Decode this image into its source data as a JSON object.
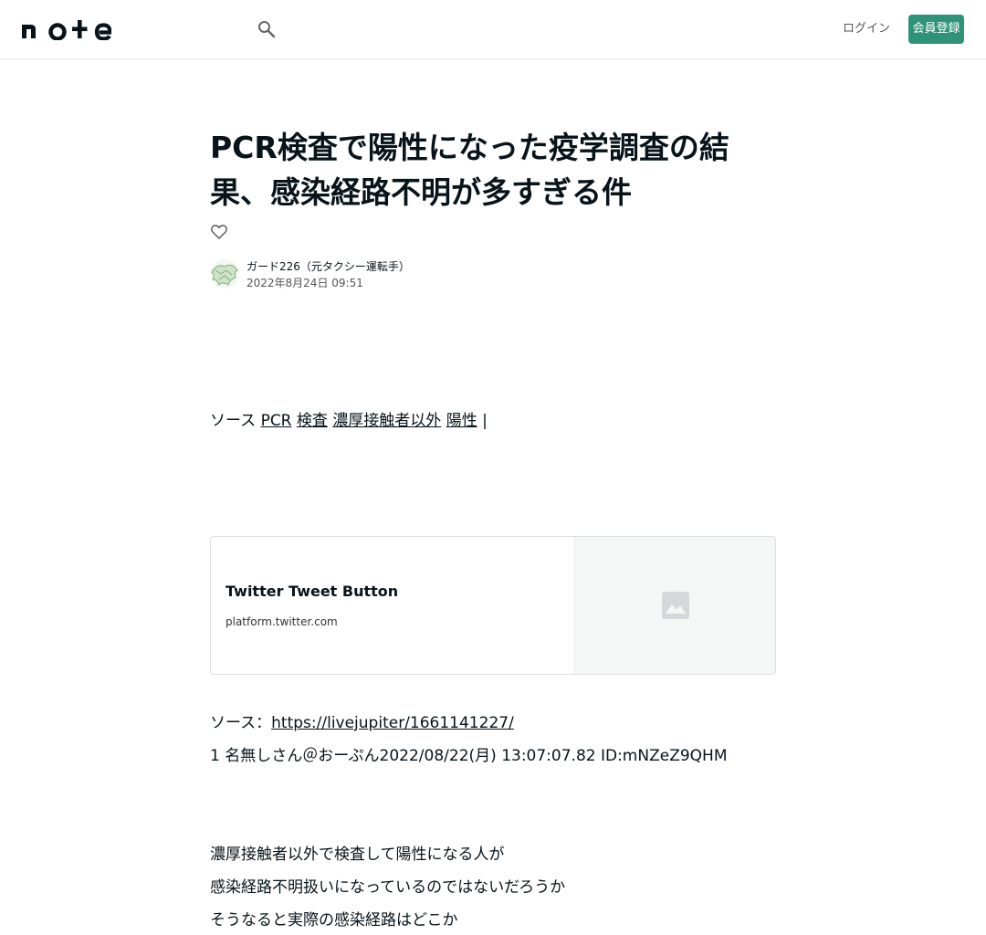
{
  "header": {
    "logo_text": "note",
    "search_icon": "search-icon",
    "login_label": "ログイン",
    "signup_label": "会員登録",
    "accent_color": "#2f9379"
  },
  "article": {
    "title": "PCR検査で陽性になった疫学調査の結果、感染経路不明が多すぎる件",
    "like_icon": "heart-icon",
    "author_name": "ガード226（元タクシー運転手）",
    "date": "2022年8月24日 09:51",
    "tags_prefix": "ソース",
    "tags": [
      "PCR",
      "検査",
      "濃厚接触者以外",
      "陽性"
    ],
    "tags_suffix": "|",
    "embed": {
      "title": "Twitter Tweet Button",
      "domain": "platform.twitter.com",
      "thumb_icon": "image-placeholder-icon"
    },
    "source_prefix": "ソース：",
    "source_link": "https://livejupiter/1661141227/",
    "post_line": "1 名無しさん＠おーぷん2022/08/22(月) 13:07:07.82 ID:mNZeZ9QHM",
    "body_lines": [
      "濃厚接触者以外で検査して陽性になる人が",
      "感染経路不明扱いになっているのではないだろうか",
      "そうなると実際の感染経路はどこか"
    ]
  }
}
